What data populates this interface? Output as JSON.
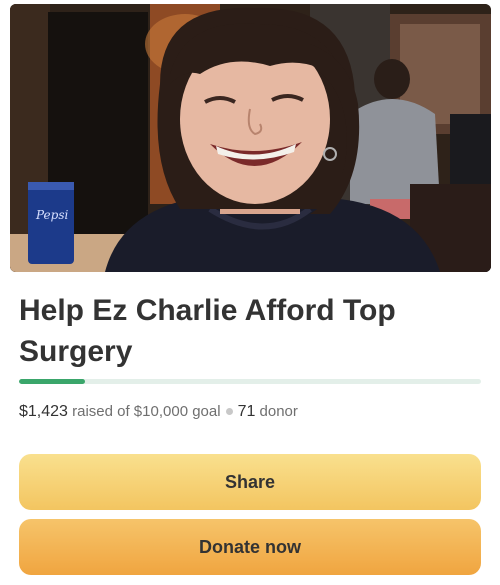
{
  "campaign": {
    "title": "Help Ez Charlie Afford Top Surgery",
    "raised": "$1,423",
    "raised_text": "raised of $10,000 goal",
    "donor_count": "71",
    "donor_label": "donor",
    "progress_fraction": 0.1423
  },
  "actions": {
    "share_label": "Share",
    "donate_label": "Donate now"
  },
  "colors": {
    "progress": "#3aa66b",
    "share_button": "#f5cf6e",
    "donate_button": "#f2b04e"
  }
}
